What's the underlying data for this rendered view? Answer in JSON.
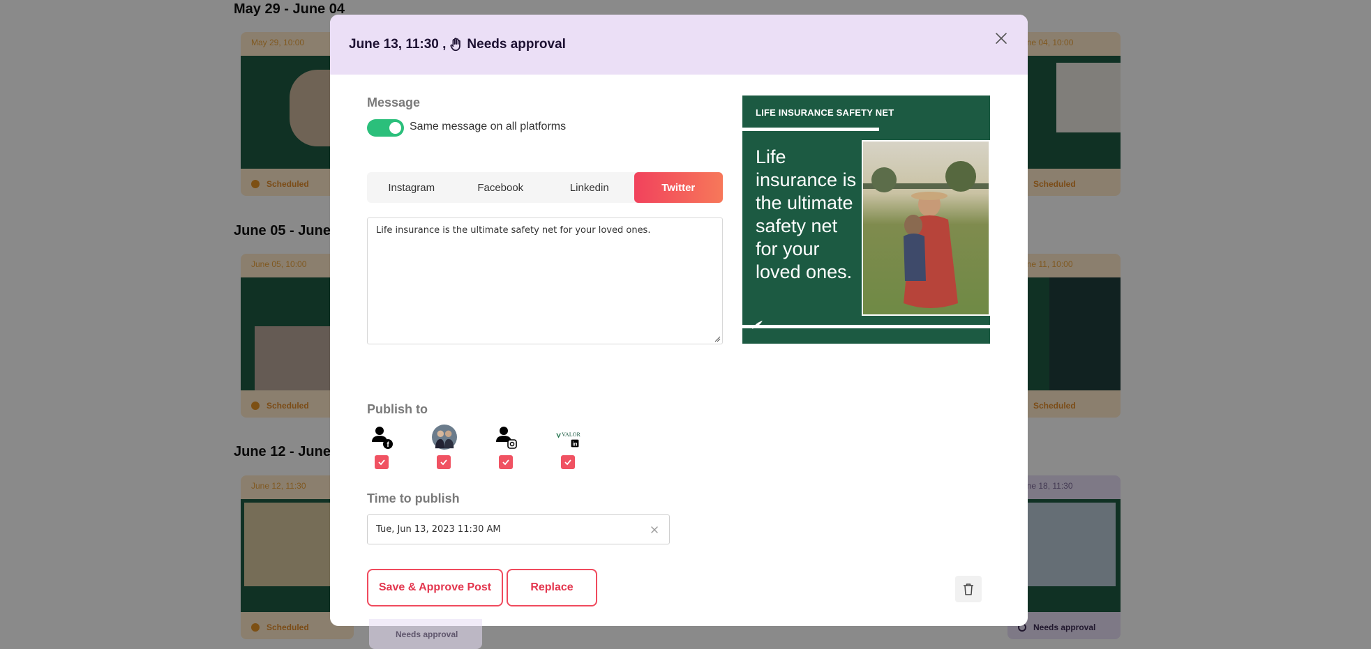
{
  "background": {
    "weeks": [
      {
        "title": "May 29 - June 04"
      },
      {
        "title": "June 05 - June 11"
      },
      {
        "title": "June 12 - June 18"
      }
    ],
    "cards": {
      "w1_left": {
        "date": "May 29, 10:00",
        "status": "Scheduled"
      },
      "w1_right": {
        "date": "June 04, 10:00",
        "status": "Scheduled"
      },
      "w2_left": {
        "date": "June 05, 10:00",
        "status": "Scheduled"
      },
      "w2_right": {
        "date": "June 11, 10:00",
        "status": "Scheduled"
      },
      "w3_left": {
        "date": "June 12, 11:30",
        "status": "Scheduled"
      },
      "w3_right": {
        "date": "June 18, 11:30",
        "status": "Needs approval"
      },
      "w3_mid": {
        "status": "Needs approval"
      }
    }
  },
  "modal": {
    "title": "June 13, 11:30 ,",
    "title_status": "Needs approval",
    "message_label": "Message",
    "toggle_label": "Same message on all platforms",
    "toggle_on": true,
    "tabs": [
      {
        "label": "Instagram",
        "active": false
      },
      {
        "label": "Facebook",
        "active": false
      },
      {
        "label": "Linkedin",
        "active": false
      },
      {
        "label": "Twitter",
        "active": true
      }
    ],
    "message_text": "Life insurance is the ultimate safety net for your loved ones.",
    "preview": {
      "headline": "LIFE INSURANCE SAFETY NET",
      "body": "Life insurance is the ultimate safety net for your loved ones."
    },
    "publish_label": "Publish to",
    "accounts": [
      {
        "icon": "facebook-user-icon",
        "checked": true
      },
      {
        "icon": "profile-photo",
        "checked": true
      },
      {
        "icon": "instagram-user-icon",
        "checked": true
      },
      {
        "icon": "linkedin-valor-logo",
        "logo_text": "VALOR",
        "checked": true
      }
    ],
    "time_label": "Time to publish",
    "time_value": "Tue, Jun 13, 2023 11:30 AM",
    "save_button": "Save & Approve Post",
    "replace_button": "Replace",
    "colors": {
      "accent": "#f04a5d",
      "header_bg": "#ebdff6",
      "toggle": "#2bbf7b",
      "brand_green": "#1c5a42"
    }
  }
}
